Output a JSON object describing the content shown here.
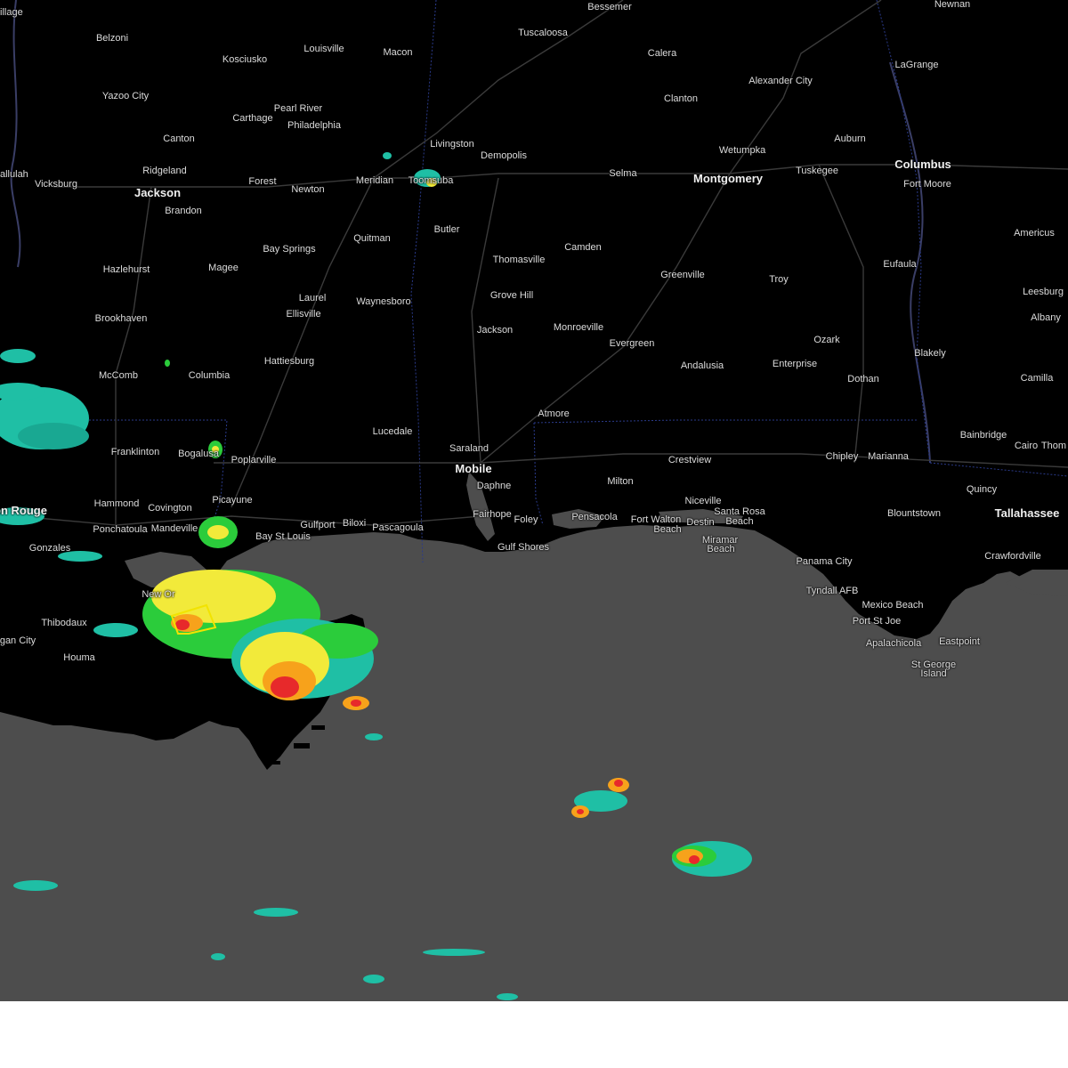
{
  "map": {
    "colors": {
      "land": "#000000",
      "water": "#4d4d4d",
      "roads": "#333333",
      "state_borders": "#2a3a8a",
      "label_text": "#dcdcdc",
      "warning_polygon": "#f2e300",
      "radar_light": "#1fbfa5",
      "radar_green": "#2bcc3b",
      "radar_yellow": "#f2ea3a",
      "radar_orange": "#f7a21b",
      "radar_red": "#e7292b"
    },
    "cities": [
      {
        "name": "Belzoni"
      },
      {
        "name": "Kosciusko"
      },
      {
        "name": "Louisville"
      },
      {
        "name": "Macon"
      },
      {
        "name": "Tuscaloosa"
      },
      {
        "name": "Bessemer"
      },
      {
        "name": "Calera"
      },
      {
        "name": "Alexander City"
      },
      {
        "name": "LaGrange"
      },
      {
        "name": "Newnan"
      },
      {
        "name": "Yazoo City"
      },
      {
        "name": "Pearl River"
      },
      {
        "name": "Carthage"
      },
      {
        "name": "Philadelphia"
      },
      {
        "name": "Clanton"
      },
      {
        "name": "Canton"
      },
      {
        "name": "Livingston"
      },
      {
        "name": "Demopolis"
      },
      {
        "name": "Wetumpka"
      },
      {
        "name": "Auburn"
      },
      {
        "name": "Ridgeland"
      },
      {
        "name": "Tuskegee"
      },
      {
        "name": "Columbus"
      },
      {
        "name": "allulah"
      },
      {
        "name": "Vicksburg"
      },
      {
        "name": "Forest"
      },
      {
        "name": "Meridian"
      },
      {
        "name": "Toomsuba"
      },
      {
        "name": "Selma"
      },
      {
        "name": "Montgomery"
      },
      {
        "name": "Fort Moore"
      },
      {
        "name": "Jackson"
      },
      {
        "name": "Newton"
      },
      {
        "name": "Brandon"
      },
      {
        "name": "Butler"
      },
      {
        "name": "Americus"
      },
      {
        "name": "Quitman"
      },
      {
        "name": "Bay Springs"
      },
      {
        "name": "Camden"
      },
      {
        "name": "Thomasville"
      },
      {
        "name": "Eufaula"
      },
      {
        "name": "Hazlehurst"
      },
      {
        "name": "Magee"
      },
      {
        "name": "Greenville"
      },
      {
        "name": "Troy"
      },
      {
        "name": "Leesburg"
      },
      {
        "name": "Laurel"
      },
      {
        "name": "Waynesboro"
      },
      {
        "name": "Grove Hill"
      },
      {
        "name": "Ellisville"
      },
      {
        "name": "Brookhaven"
      },
      {
        "name": "Albany"
      },
      {
        "name": "Monroeville"
      },
      {
        "name": "Jackson"
      },
      {
        "name": "Ozark"
      },
      {
        "name": "Evergreen"
      },
      {
        "name": "Blakely"
      },
      {
        "name": "Hattiesburg"
      },
      {
        "name": "Andalusia"
      },
      {
        "name": "Enterprise"
      },
      {
        "name": "McComb"
      },
      {
        "name": "Columbia"
      },
      {
        "name": "Dothan"
      },
      {
        "name": "Camilla"
      },
      {
        "name": "Atmore"
      },
      {
        "name": "Lucedale"
      },
      {
        "name": "Bainbridge"
      },
      {
        "name": "Saraland"
      },
      {
        "name": "Franklinton"
      },
      {
        "name": "Cairo"
      },
      {
        "name": "Thom"
      },
      {
        "name": "Bogalusa"
      },
      {
        "name": "Chipley"
      },
      {
        "name": "Marianna"
      },
      {
        "name": "Crestview"
      },
      {
        "name": "Poplarville"
      },
      {
        "name": "Mobile"
      },
      {
        "name": "Milton"
      },
      {
        "name": "Daphne"
      },
      {
        "name": "Quincy"
      },
      {
        "name": "Picayune"
      },
      {
        "name": "Niceville"
      },
      {
        "name": "Hammond"
      },
      {
        "name": "Covington"
      },
      {
        "name": "Santa Rosa"
      },
      {
        "name": "Beach"
      },
      {
        "name": "Blountstown"
      },
      {
        "name": "Fairhope"
      },
      {
        "name": "on Rouge"
      },
      {
        "name": "Tallahassee"
      },
      {
        "name": "Pensacola"
      },
      {
        "name": "Foley"
      },
      {
        "name": "Gulfport"
      },
      {
        "name": "Biloxi"
      },
      {
        "name": "Fort Walton"
      },
      {
        "name": "Destin"
      },
      {
        "name": "Ponchatoula"
      },
      {
        "name": "Mandeville"
      },
      {
        "name": "Pascagoula"
      },
      {
        "name": "Beach"
      },
      {
        "name": "Miramar"
      },
      {
        "name": "Bay St Louis"
      },
      {
        "name": "Gonzales"
      },
      {
        "name": "Beach"
      },
      {
        "name": "Gulf Shores"
      },
      {
        "name": "Crawfordville"
      },
      {
        "name": "Panama City"
      },
      {
        "name": "New Or"
      },
      {
        "name": "Tyndall AFB"
      },
      {
        "name": "Mexico Beach"
      },
      {
        "name": "Thibodaux"
      },
      {
        "name": "Port St Joe"
      },
      {
        "name": "gan City"
      },
      {
        "name": "Apalachicola"
      },
      {
        "name": "Eastpoint"
      },
      {
        "name": "Houma"
      },
      {
        "name": "St George"
      },
      {
        "name": "Island"
      },
      {
        "name": "illage"
      }
    ]
  }
}
